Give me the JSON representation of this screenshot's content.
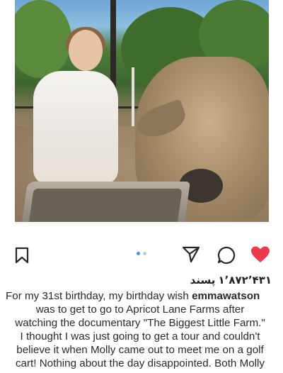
{
  "post": {
    "image_alt_icon": "photo",
    "likes": {
      "count": "۱٬۸۷۲٬۴۳۱",
      "label": "پسند"
    },
    "caption": {
      "lead": "For my 31st birthday, my birthday wish",
      "username": "emmawatson",
      "line2": "was to get to go to Apricot Lane Farms after",
      "line3": "watching the documentary \"The Biggest Little Farm.\"",
      "line4": "I thought I was just going to get a tour and couldn't",
      "line5": "believe it when Molly came out to meet me on a golf",
      "line6": "cart! Nothing about the day disappointed. Both Molly"
    }
  },
  "actions": {
    "save_icon": "bookmark-icon",
    "share_icon": "send-icon",
    "comment_icon": "comment-icon",
    "like_icon": "heart-icon",
    "like_color": "#ee3a4f",
    "dot_active_color": "#3897f0",
    "dot_inactive_color": "#c7c7c7"
  }
}
